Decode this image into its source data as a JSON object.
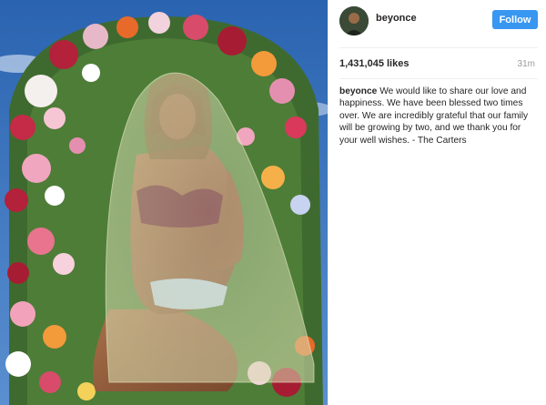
{
  "post": {
    "username": "beyonce",
    "follow_label": "Follow",
    "likes": "1,431,045 likes",
    "time_ago": "31m",
    "caption_user": "beyonce",
    "caption_text": "We would like to share our love and happiness. We have been blessed two times over. We are incredibly grateful that our family will be growing by two, and we thank you for your well wishes. - The Carters"
  },
  "colors": {
    "follow_button": "#3897f0",
    "muted_text": "#999999",
    "sky": "#2f6fb8"
  },
  "icons": {
    "avatar": "profile-photo"
  }
}
